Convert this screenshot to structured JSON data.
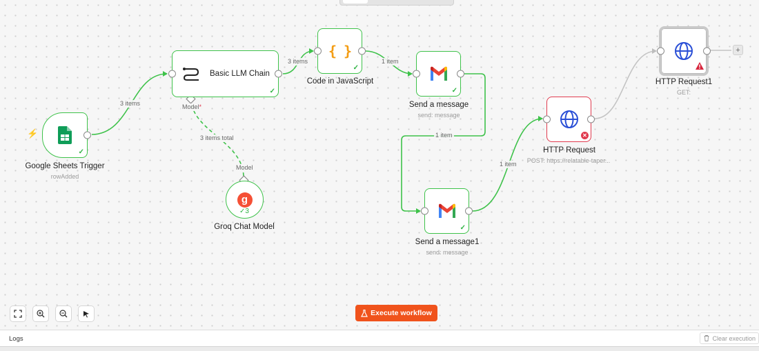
{
  "nodes": {
    "sheets_trigger": {
      "title": "Google Sheets Trigger",
      "subtitle": "rowAdded"
    },
    "llm_chain": {
      "title": "Basic LLM Chain",
      "model_label": "Model",
      "required_mark": "*"
    },
    "code_js": {
      "title": "Code in JavaScript",
      "icon_text": "{ }"
    },
    "send_message": {
      "title": "Send a message",
      "subtitle": "send: message"
    },
    "send_message1": {
      "title": "Send a message1",
      "subtitle": "send: message"
    },
    "http_request": {
      "title": "HTTP Request",
      "subtitle": "POST: https://relatable-taper..."
    },
    "http_request1": {
      "title": "HTTP Request1",
      "subtitle": "GET:"
    },
    "groq_model": {
      "title": "Groq Chat Model",
      "model_label": "Model",
      "run_count": "3",
      "icon_text": "g"
    }
  },
  "edges": {
    "trigger_to_llm": "3 items",
    "llm_to_code": "3 items",
    "code_to_send": "1 item",
    "send_to_send1": "1 item",
    "send1_to_http": "1 item",
    "model_to_llm": "3 items total"
  },
  "toolbar": {
    "execute_label": "Execute workflow",
    "fit_icon": "fit-view-icon",
    "zoom_in_icon": "zoom-in-icon",
    "zoom_out_icon": "zoom-out-icon",
    "tidy_icon": "tidy-up-icon"
  },
  "logs": {
    "label": "Logs",
    "clear_label": "Clear execution"
  },
  "colors": {
    "success": "#3ec24a",
    "error": "#e03a4e",
    "accent": "#f0531c",
    "gmail_red": "#ea4335",
    "sheets_green": "#0f9d58",
    "globe_blue": "#2a4fd6",
    "code_orange": "#f39c12"
  }
}
